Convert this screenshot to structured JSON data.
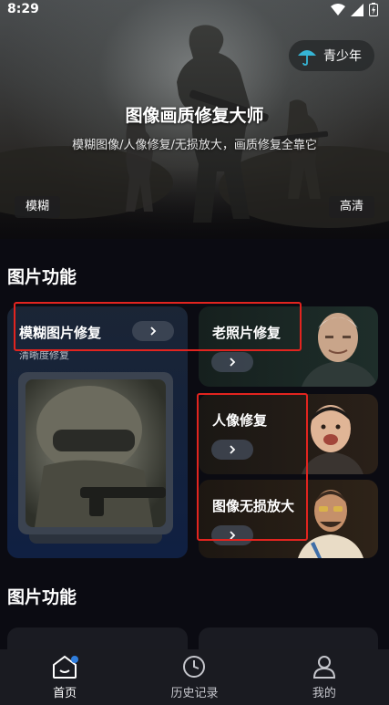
{
  "status_bar": {
    "time": "8:29"
  },
  "hero": {
    "title": "图像画质修复大师",
    "subtitle": "模糊图像/人像修复/无损放大，画质修复全靠它",
    "youth_mode_label": "青少年",
    "tag_left": "模糊",
    "tag_right": "高清"
  },
  "section1": {
    "title": "图片功能",
    "big_card": {
      "label": "模糊图片修复",
      "sub": "清晰度修复"
    },
    "cards": [
      {
        "label": "老照片修复"
      },
      {
        "label": "人像修复"
      },
      {
        "label": "图像无损放大"
      }
    ]
  },
  "section2": {
    "title": "图片功能"
  },
  "bottom_nav": [
    {
      "label": "首页",
      "icon": "home-icon",
      "active": true
    },
    {
      "label": "历史记录",
      "icon": "clock-icon",
      "active": false
    },
    {
      "label": "我的",
      "icon": "user-icon",
      "active": false
    }
  ],
  "colors": {
    "highlight_box": "#e2241f",
    "background": "#0b0b12",
    "nav_bg": "#1a1b21",
    "accent_blue": "#2f7ddc"
  }
}
